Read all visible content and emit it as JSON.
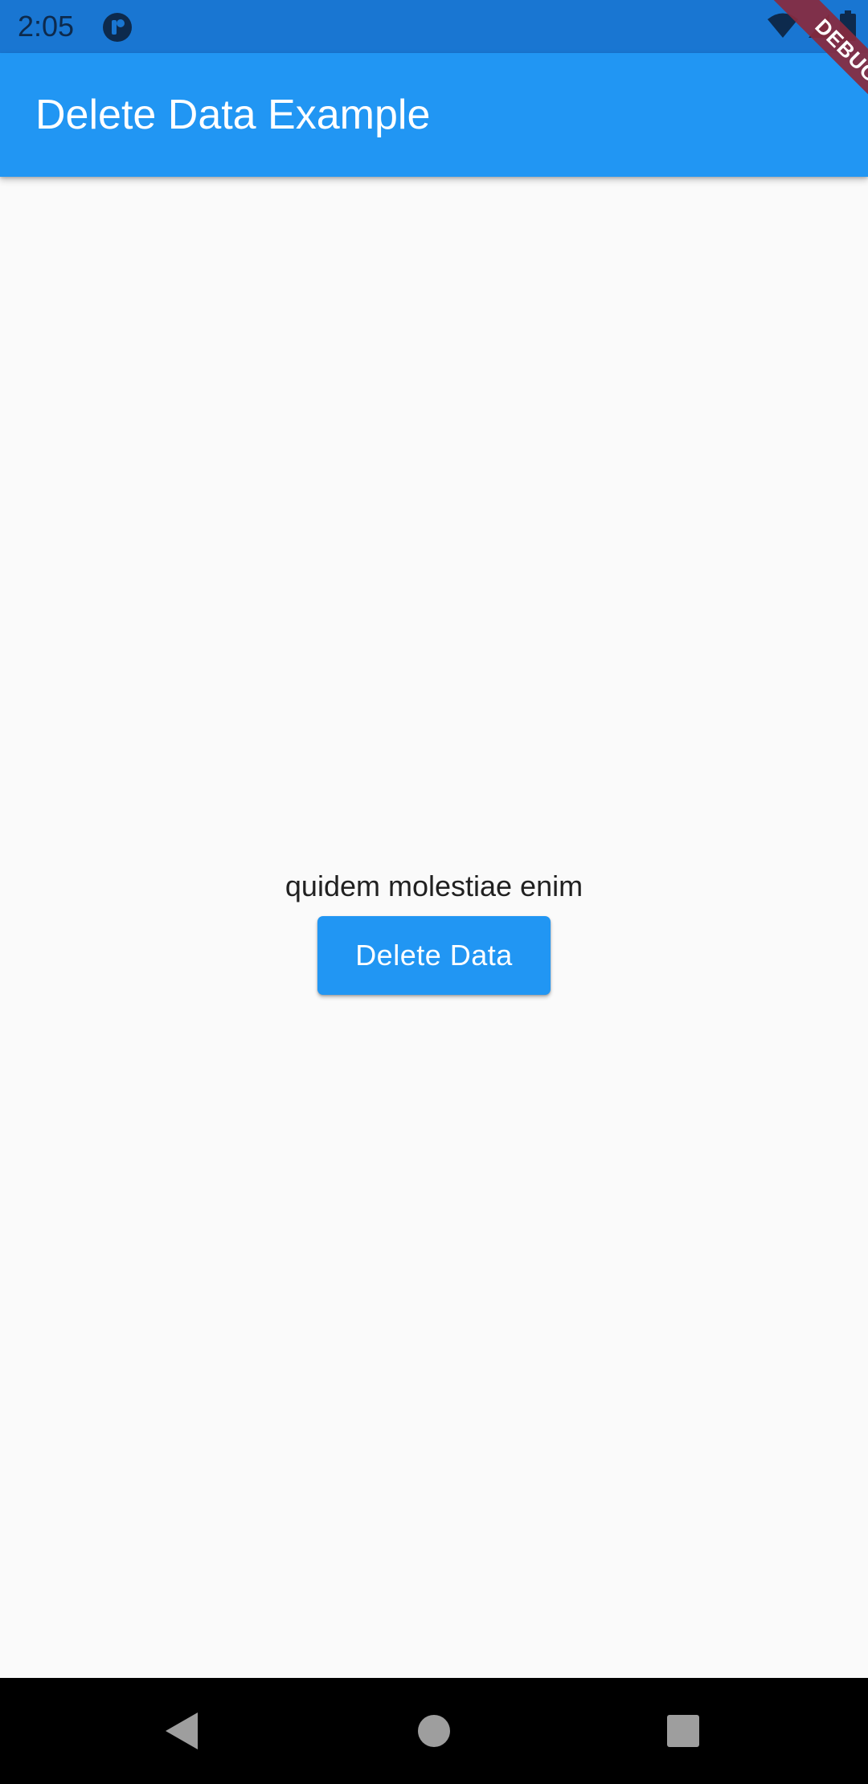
{
  "status_bar": {
    "time": "2:05",
    "icons": [
      "app-notification-icon",
      "wifi-icon",
      "cell-signal-icon",
      "battery-icon"
    ]
  },
  "app_bar": {
    "title": "Delete Data Example"
  },
  "debug_banner": {
    "label": "DEBUG"
  },
  "content": {
    "item_title": "quidem molestiae enim",
    "delete_button_label": "Delete Data"
  },
  "nav_bar": {
    "icons": [
      "back-icon",
      "home-icon",
      "recents-icon"
    ]
  },
  "colors": {
    "primary": "#2196f3",
    "status_bar": "#1976d2",
    "background": "#fafafa",
    "debug_banner": "#882a3e"
  }
}
